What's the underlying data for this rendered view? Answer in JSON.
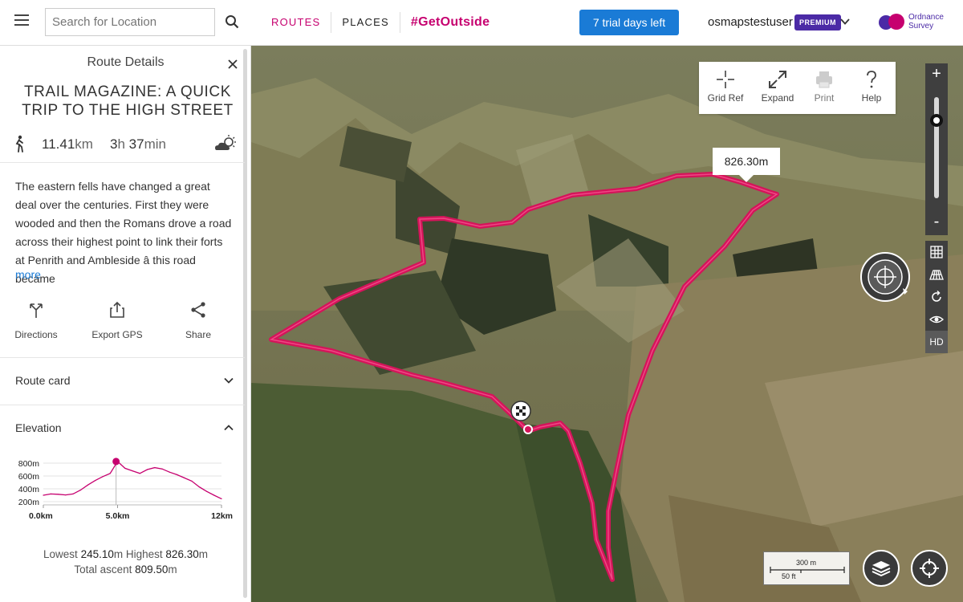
{
  "header": {
    "search_placeholder": "Search for Location",
    "nav": {
      "routes": "ROUTES",
      "places": "PLACES",
      "hashtag": "#GetOutside"
    },
    "trial_button": "7 trial days left",
    "username": "osmapstestuser",
    "premium_badge": "PREMIUM",
    "logo_line1": "Ordnance",
    "logo_line2": "Survey",
    "accent_color": "#c6006f",
    "brand_color": "#4b2aa6",
    "button_color": "#1a7bd6"
  },
  "panel": {
    "header": "Route Details",
    "title": "TRAIL MAGAZINE: A QUICK TRIP TO THE HIGH STREET",
    "distance_value": "11.41",
    "distance_unit": "km",
    "duration_hours": "3",
    "duration_h_unit": "h",
    "duration_minutes": "37",
    "duration_m_unit": "min",
    "description": "The eastern fells have changed a great deal over the centuries. First they were wooded and then the Romans drove a road across their highest point to link their forts at Penrith and Ambleside â this road became",
    "more_link": "more",
    "actions": {
      "directions": "Directions",
      "export": "Export GPS",
      "share": "Share"
    },
    "route_card": "Route card",
    "elevation_label": "Elevation",
    "elevation": {
      "lowest_label": "Lowest",
      "lowest_value": "245.10",
      "highest_label": "Highest",
      "highest_value": "826.30",
      "ascent_label": "Total ascent",
      "ascent_value": "809.50",
      "unit": "m"
    }
  },
  "chart_data": {
    "type": "area",
    "title": "",
    "xlabel": "",
    "ylabel": "",
    "x_ticks": [
      "0.0km",
      "5.0km",
      "12km"
    ],
    "y_ticks": [
      "800m",
      "600m",
      "400m",
      "200m"
    ],
    "xlim": [
      0,
      12
    ],
    "ylim": [
      150,
      850
    ],
    "x": [
      0,
      0.5,
      1,
      1.5,
      2,
      2.5,
      3,
      3.5,
      4,
      4.5,
      5,
      5.5,
      6,
      6.5,
      7,
      7.5,
      8,
      8.5,
      9,
      9.5,
      10,
      10.5,
      11,
      11.5,
      12
    ],
    "y": [
      300,
      320,
      315,
      305,
      320,
      380,
      460,
      530,
      590,
      640,
      826,
      720,
      680,
      640,
      700,
      730,
      710,
      660,
      620,
      570,
      520,
      430,
      360,
      300,
      245
    ],
    "highlight": {
      "x": 4.9,
      "y": 826
    },
    "color": "#c6006f"
  },
  "map": {
    "elevation_tooltip": "826.30m",
    "tools": {
      "grid_ref": "Grid Ref",
      "expand": "Expand",
      "print": "Print",
      "help": "Help"
    },
    "zoom_in": "+",
    "zoom_out": "-",
    "zoom_level_fraction": 0.19,
    "hd_label": "HD",
    "scale_top": "300 m",
    "scale_bottom": "50 ft",
    "route_color": "#d4145a"
  }
}
